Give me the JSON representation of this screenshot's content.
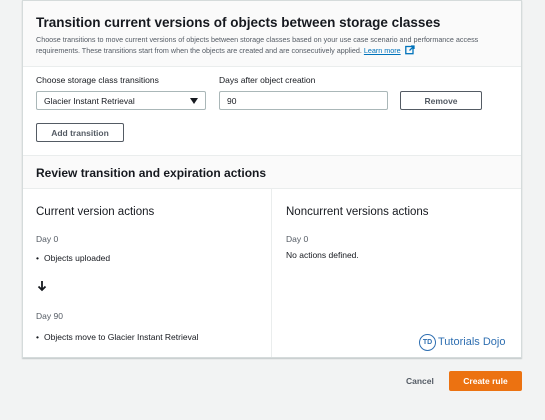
{
  "transitions_section": {
    "title": "Transition current versions of objects between storage classes",
    "description": "Choose transitions to move current versions of objects between storage classes based on your use case scenario and performance access requirements. These transitions start from when the objects are created and are consecutively applied.",
    "learn_more": "Learn more",
    "storage_class_label": "Choose storage class transitions",
    "storage_class_value": "Glacier Instant Retrieval",
    "days_label": "Days after object creation",
    "days_value": "90",
    "remove_label": "Remove",
    "add_transition_label": "Add transition"
  },
  "review": {
    "title": "Review transition and expiration actions",
    "current": {
      "title": "Current version actions",
      "day0": "Day 0",
      "uploaded": "Objects uploaded",
      "day90": "Day 90",
      "move": "Objects move to Glacier Instant Retrieval"
    },
    "noncurrent": {
      "title": "Noncurrent versions actions",
      "day0": "Day 0",
      "none": "No actions defined."
    }
  },
  "watermark": {
    "logo_text": "TD",
    "text": "Tutorials Dojo"
  },
  "footer": {
    "cancel": "Cancel",
    "create": "Create rule"
  },
  "colors": {
    "accent": "#ec7211",
    "link": "#0073bb",
    "watermark": "#2f6fb1"
  },
  "icons": {
    "external_link": "external-link-icon",
    "dropdown": "caret-down-icon",
    "down_arrow": "arrow-down-icon"
  }
}
